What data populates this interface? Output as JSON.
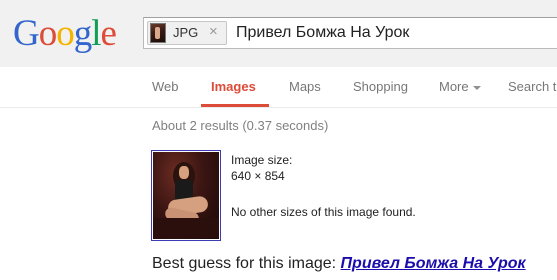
{
  "logo": {
    "letters": [
      {
        "char": "G",
        "color": "#3366cc"
      },
      {
        "char": "o",
        "color": "#dd4b39"
      },
      {
        "char": "o",
        "color": "#f4b400"
      },
      {
        "char": "g",
        "color": "#3366cc"
      },
      {
        "char": "l",
        "color": "#0f9d58"
      },
      {
        "char": "e",
        "color": "#dd4b39"
      }
    ]
  },
  "search": {
    "chip_label": "JPG",
    "chip_close": "×",
    "chip_thumb_icon": "image-thumbnail-icon",
    "query": "Привел Бомжа На Урок"
  },
  "tabs": [
    {
      "label": "Web"
    },
    {
      "label": "Images",
      "active": true
    },
    {
      "label": "Maps"
    },
    {
      "label": "Shopping"
    },
    {
      "label": "More"
    },
    {
      "label": "Search t"
    }
  ],
  "more_caret_icon": "caret-down-icon",
  "stats": "About 2 results (0.37 seconds)",
  "result": {
    "size_label": "Image size:",
    "size_value": "640 × 854",
    "no_other": "No other sizes of this image found."
  },
  "best_guess": {
    "prefix": "Best guess for this image:",
    "link": "Привел Бомжа На Урок"
  },
  "colors": {
    "accent": "#dd4b39",
    "link": "#1a0dab",
    "header_bg": "#f1f1f1",
    "muted": "#777777"
  }
}
